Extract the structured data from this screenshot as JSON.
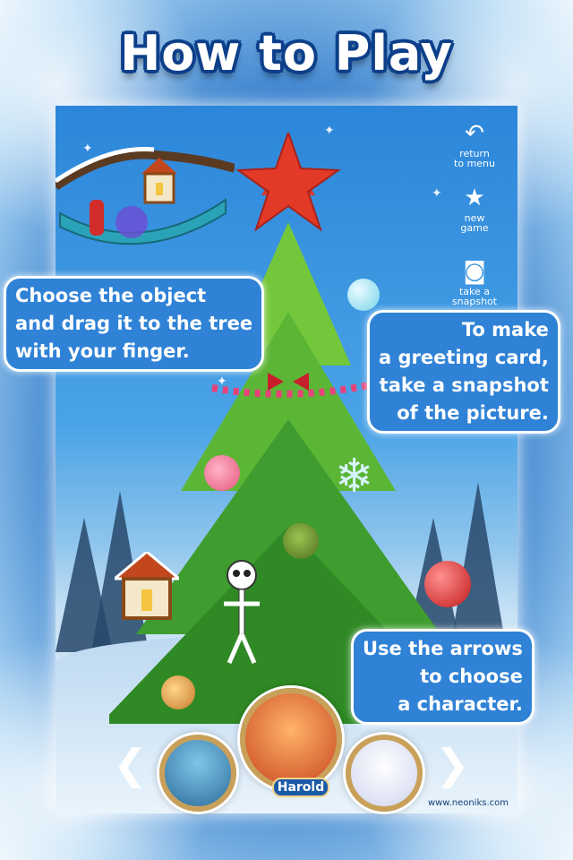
{
  "page": {
    "title": "How to Play"
  },
  "menu": {
    "return": "return\nto menu",
    "new_game": "new\ngame",
    "snapshot": "take a\nsnapshot"
  },
  "hints": {
    "drag": [
      "Choose the object",
      "and drag it to the tree",
      "with your finger."
    ],
    "snapshot": [
      "To make",
      "a greeting card,",
      "take a snapshot",
      "of the picture."
    ],
    "arrows": [
      "Use the arrows",
      "to choose",
      "a character."
    ]
  },
  "characters": {
    "selected_name": "Harold"
  },
  "footer": {
    "copyright": "www.neoniks.com"
  },
  "colors": {
    "bubble": "#2f82d6",
    "title_outline": "#0d3f8a",
    "tree": "#4aa832",
    "frame_gold": "#c9a05a"
  },
  "icons": [
    "return-arrow-icon",
    "star-icon",
    "camera-icon",
    "snowflake-icon",
    "tree-star-icon"
  ]
}
